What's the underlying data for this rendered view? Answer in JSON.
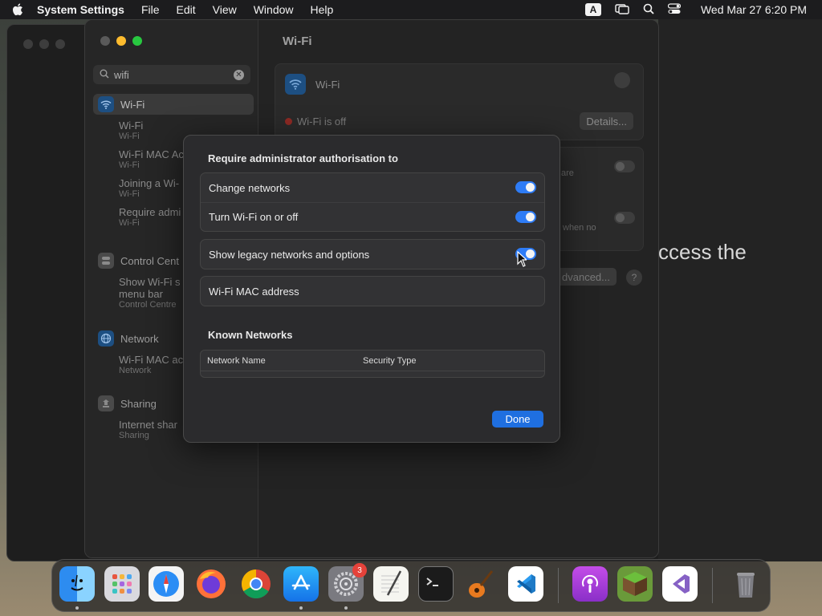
{
  "menubar": {
    "app_name": "System Settings",
    "items": [
      "File",
      "Edit",
      "View",
      "Window",
      "Help"
    ],
    "input_badge": "A",
    "clock": "Wed Mar 27  6:20 PM"
  },
  "background": {
    "partial_text": "ccess the"
  },
  "sidebar": {
    "search_value": "wifi",
    "groups": [
      {
        "title": "Wi-Fi",
        "icon": "wifi-icon",
        "active": true,
        "subs": [
          {
            "title": "Wi-Fi",
            "sub": "Wi-Fi"
          },
          {
            "title": "Wi-Fi MAC Ac",
            "sub": "Wi-Fi"
          },
          {
            "title": "Joining a Wi-",
            "sub": "Wi-Fi"
          },
          {
            "title": "Require admi",
            "sub": "Wi-Fi"
          }
        ]
      },
      {
        "title": "Control Cent",
        "icon": "control-centre-icon",
        "subs": [
          {
            "title": "Show Wi-Fi s",
            "title2": "menu bar",
            "sub": "Control Centre"
          }
        ]
      },
      {
        "title": "Network",
        "icon": "network-globe-icon",
        "subs": [
          {
            "title": "Wi-Fi MAC ac",
            "sub": "Network"
          }
        ]
      },
      {
        "title": "Sharing",
        "icon": "sharing-icon",
        "subs": [
          {
            "title": "Internet shar",
            "sub": "Sharing"
          }
        ]
      }
    ]
  },
  "content": {
    "title": "Wi-Fi",
    "wifi_label": "Wi-Fi",
    "status": "Wi-Fi is off",
    "details_button": "Details...",
    "frag1": "are",
    "frag2": "when no",
    "advanced_button": "dvanced...",
    "help_button": "?"
  },
  "sheet": {
    "heading": "Require administrator authorisation to",
    "rows_group1": [
      {
        "label": "Change networks",
        "on": true
      },
      {
        "label": "Turn Wi-Fi on or off",
        "on": true
      }
    ],
    "legacy_label": "Show legacy networks and options",
    "mac_label": "Wi-Fi MAC address",
    "known_heading": "Known Networks",
    "table_columns": [
      "Network Name",
      "Security Type"
    ],
    "done_button": "Done"
  },
  "dock": {
    "apps": [
      "finder-icon",
      "launchpad-icon",
      "safari-icon",
      "firefox-icon",
      "chrome-icon",
      "app-store-icon",
      "system-settings-icon",
      "textedit-icon",
      "terminal-icon",
      "garageband-icon",
      "vscode-icon",
      "podcasts-icon",
      "minecraft-icon",
      "visual-studio-icon",
      "trash-icon"
    ],
    "settings_badge": "3"
  },
  "colors": {
    "accent": "#2e7cf6",
    "done_button": "#1f6fe0"
  }
}
